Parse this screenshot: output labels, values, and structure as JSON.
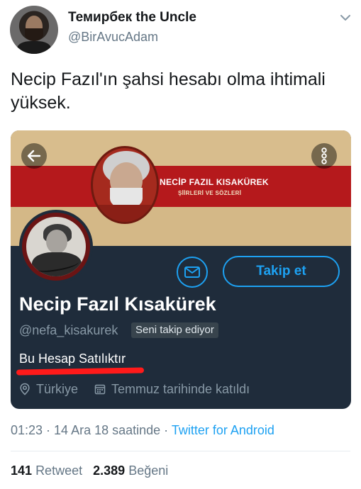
{
  "tweet": {
    "author_name": "Темирбек the Uncle",
    "author_handle": "@BirAvucAdam",
    "text": "Necip Fazıl'ın şahsi hesabı olma ihtimali yüksek.",
    "time": "01:23",
    "separator": " · ",
    "date": "14 Ara 18 saatinde",
    "source": "Twitter for Android",
    "retweets_count": "141",
    "retweets_label": "Retweet",
    "likes_count": "2.389",
    "likes_label": "Beğeni"
  },
  "profile_card": {
    "banner_title": "NECİP FAZIL KISAKÜREK",
    "banner_subtitle": "ŞİİRLERİ VE SÖZLERİ",
    "name": "Necip Fazıl Kısakürek",
    "handle": "@nefa_kisakurek",
    "follows_you": "Seni takip ediyor",
    "bio": "Bu Hesap Satılıktır",
    "location": "Türkiye",
    "joined": "Temmuz tarihinde katıldı",
    "follow_label": "Takip et"
  },
  "colors": {
    "accent": "#1da1f2",
    "card_background": "#1f2c3b",
    "banner_red": "#b5191c",
    "highlight_red": "#ff1a1a"
  },
  "icons": [
    "caret-down-icon",
    "back-arrow-icon",
    "more-vertical-icon",
    "mail-icon",
    "location-pin-icon",
    "calendar-icon"
  ]
}
